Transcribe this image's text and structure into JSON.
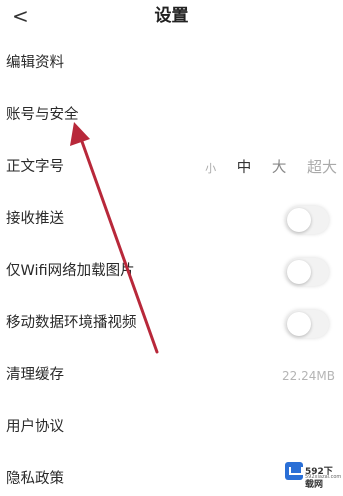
{
  "header": {
    "back_icon": "chevron-left-icon",
    "back_glyph": "<",
    "title": "设置"
  },
  "rows": {
    "edit_profile": "编辑资料",
    "account_security": "账号与安全",
    "font_size": "正文字号",
    "receive_push": "接收推送",
    "wifi_only_images": "仅Wifi网络加载图片",
    "mobile_autoplay": "移动数据环境播视频",
    "clear_cache": "清理缓存",
    "user_agreement": "用户协议",
    "privacy_policy": "隐私政策"
  },
  "font_sizes": {
    "small": "小",
    "medium": "中",
    "large": "大",
    "xlarge": "超大",
    "selected": "中"
  },
  "toggles": {
    "receive_push": false,
    "wifi_only_images": false,
    "mobile_autoplay": false
  },
  "cache_size": "22.24MB",
  "watermark": {
    "text": "592下载网",
    "sub": "592xiazai.com"
  },
  "colors": {
    "arrow": "#b8283a"
  }
}
